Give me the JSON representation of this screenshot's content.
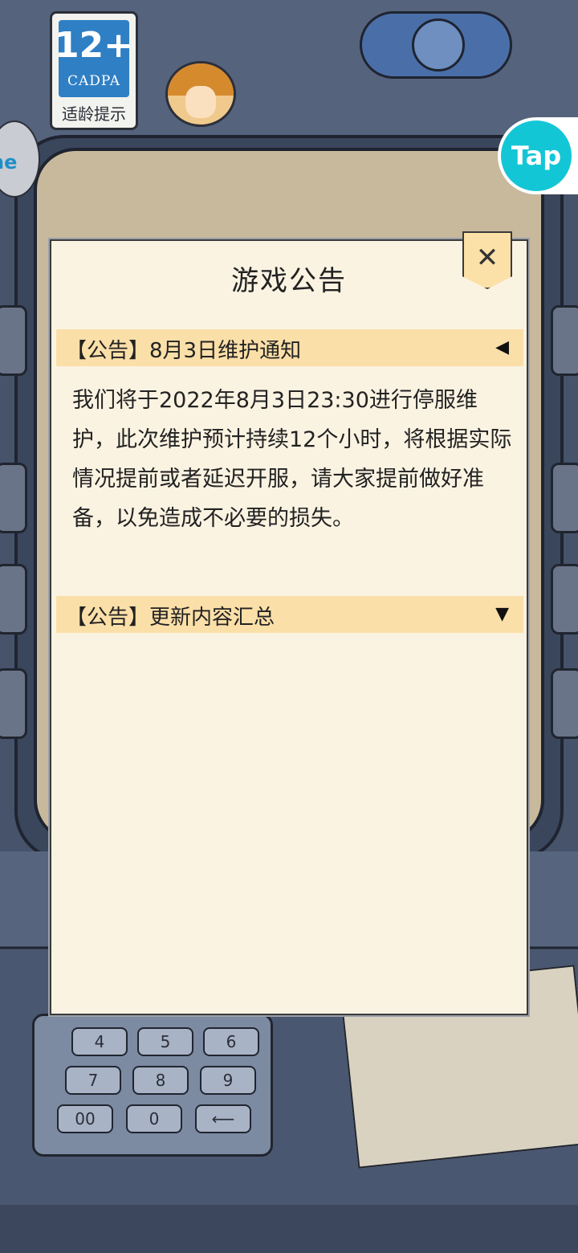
{
  "badges": {
    "age_number": "12+",
    "age_org": "CADPA",
    "age_tip": "适龄提示",
    "tap_logo": "Tap",
    "left_chip": "ne"
  },
  "keypad": {
    "keys": [
      "4",
      "5",
      "6",
      "7",
      "8",
      "9",
      "00",
      "0",
      "⟵"
    ]
  },
  "dialog": {
    "title": "游戏公告",
    "close_icon": "✕",
    "notices": [
      {
        "title": "【公告】8月3日维护通知",
        "arrow": "◀",
        "expanded": true,
        "body": "我们将于2022年8月3日23:30进行停服维护，此次维护预计持续12个小时，将根据实际情况提前或者延迟开服，请大家提前做好准备，以免造成不必要的损失。"
      },
      {
        "title": "【公告】更新内容汇总",
        "arrow": "▼",
        "expanded": false
      }
    ]
  }
}
